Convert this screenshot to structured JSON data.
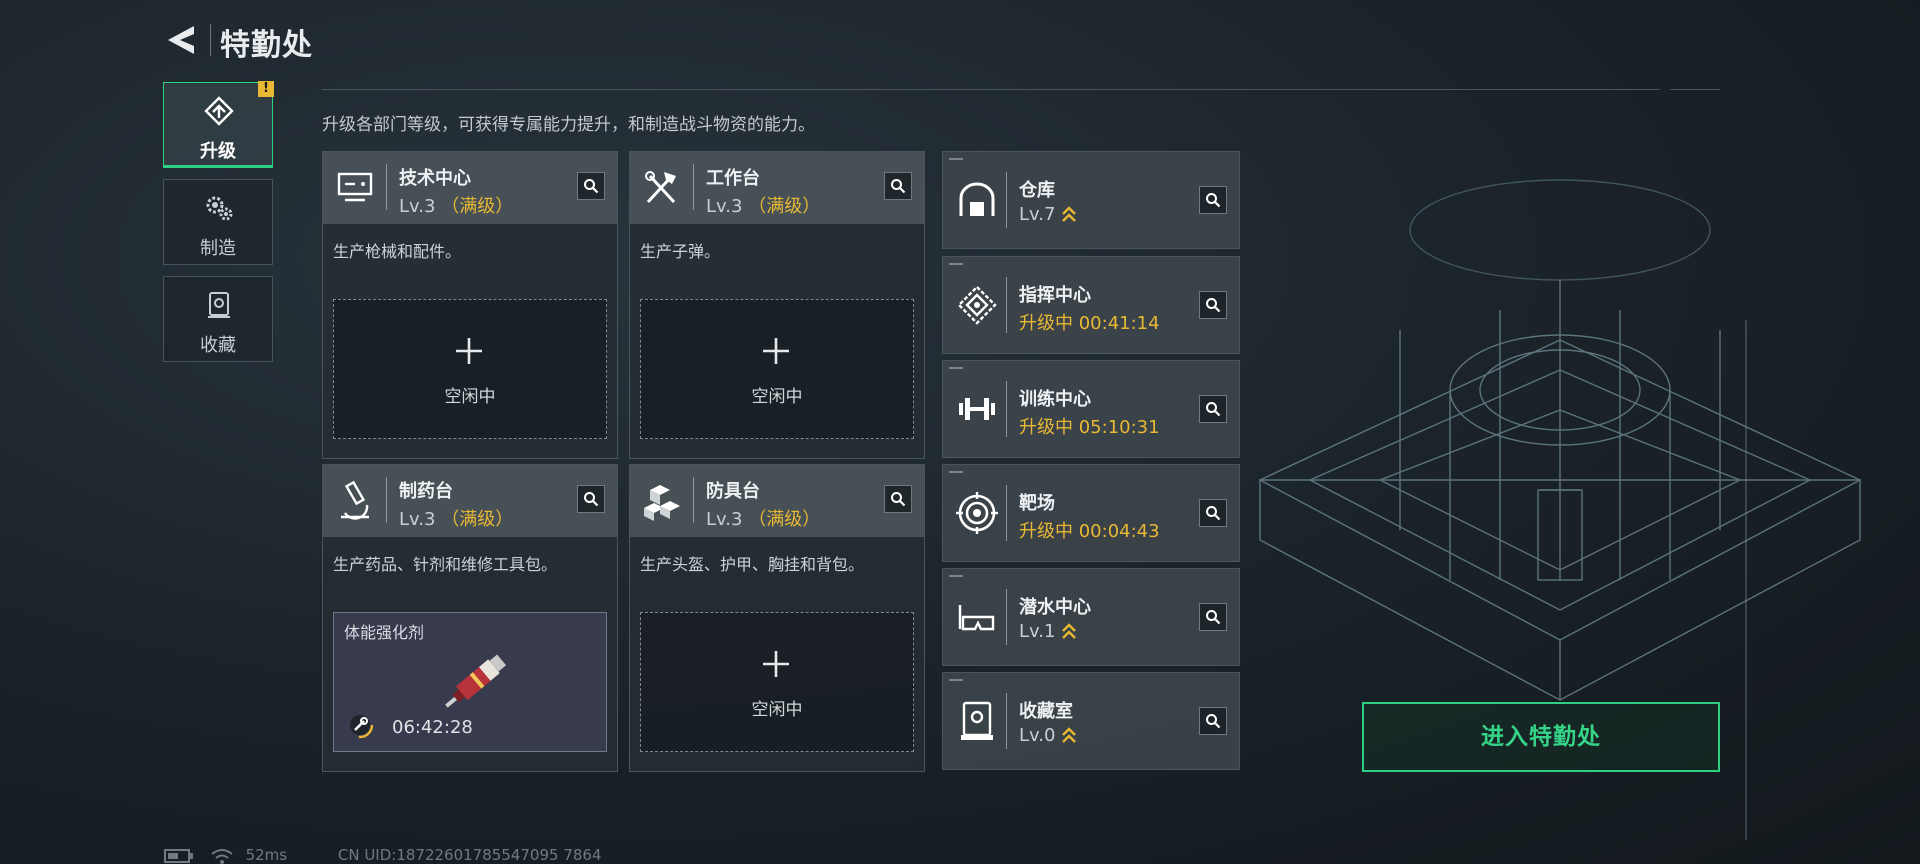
{
  "header": {
    "title": "特勤处"
  },
  "sidebar": {
    "tabs": [
      {
        "label": "升级",
        "icon": "upgrade-icon",
        "active": true,
        "alert": "!"
      },
      {
        "label": "制造",
        "icon": "gears-icon",
        "active": false
      },
      {
        "label": "收藏",
        "icon": "collection-icon",
        "active": false
      }
    ]
  },
  "description": "升级各部门等级，可获得专属能力提升，和制造战斗物资的能力。",
  "departments": [
    {
      "name": "技术中心",
      "level": "Lv.3",
      "status": "（满级）",
      "desc": "生产枪械和配件。",
      "slot": {
        "text": "空闲中"
      },
      "icon": "tech-center-icon"
    },
    {
      "name": "工作台",
      "level": "Lv.3",
      "status": "（满级）",
      "desc": "生产子弹。",
      "slot": {
        "text": "空闲中"
      },
      "icon": "workbench-tools-icon"
    },
    {
      "name": "制药台",
      "level": "Lv.3",
      "status": "（满级）",
      "desc": "生产药品、针剂和维修工具包。",
      "slot": {
        "item": "体能强化剂",
        "timer": "06:42:28"
      },
      "icon": "microscope-icon"
    },
    {
      "name": "防具台",
      "level": "Lv.3",
      "status": "（满级）",
      "desc": "生产头盔、护甲、胸挂和背包。",
      "slot": {
        "text": "空闲中"
      },
      "icon": "armor-blocks-icon"
    }
  ],
  "facilities": [
    {
      "name": "仓库",
      "level": "Lv.7",
      "upgradable": true,
      "icon": "warehouse-icon"
    },
    {
      "name": "指挥中心",
      "status": "升级中",
      "timer": "00:41:14",
      "icon": "command-center-icon"
    },
    {
      "name": "训练中心",
      "status": "升级中",
      "timer": "05:10:31",
      "icon": "dumbbell-icon"
    },
    {
      "name": "靶场",
      "status": "升级中",
      "timer": "00:04:43",
      "icon": "target-icon"
    },
    {
      "name": "潜水中心",
      "level": "Lv.1",
      "upgradable": true,
      "icon": "diving-goggles-icon"
    },
    {
      "name": "收藏室",
      "level": "Lv.0",
      "upgradable": true,
      "icon": "display-case-icon"
    }
  ],
  "enter_button": {
    "label": "进入特勤处"
  },
  "status_bar": {
    "ping": "52ms",
    "uid": "CN UID:18722601785547095 7864"
  },
  "colors": {
    "accent_green": "#2fcf83",
    "gold": "#e8b834"
  }
}
